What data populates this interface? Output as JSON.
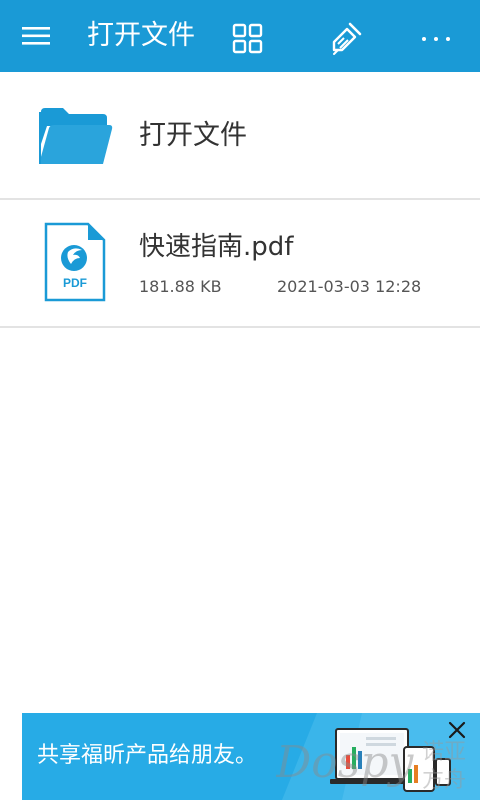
{
  "header": {
    "title": "打开文件",
    "menu_icon": "hamburger-menu-icon",
    "grid_icon": "grid-view-icon",
    "clean_icon": "broom-icon",
    "more_icon": "more-dots-icon",
    "bg_color": "#1a9ad6"
  },
  "list": {
    "open_folder": {
      "label": "打开文件",
      "icon": "folder-icon"
    },
    "files": [
      {
        "name": "快速指南.pdf",
        "size": "181.88 KB",
        "modified": "2021-03-03 12:28",
        "icon": "pdf-file-icon",
        "icon_badge": "PDF"
      }
    ]
  },
  "banner": {
    "text": "共享福昕产品给朋友。",
    "close_icon": "close-icon",
    "bg_color": "#27abe6"
  }
}
